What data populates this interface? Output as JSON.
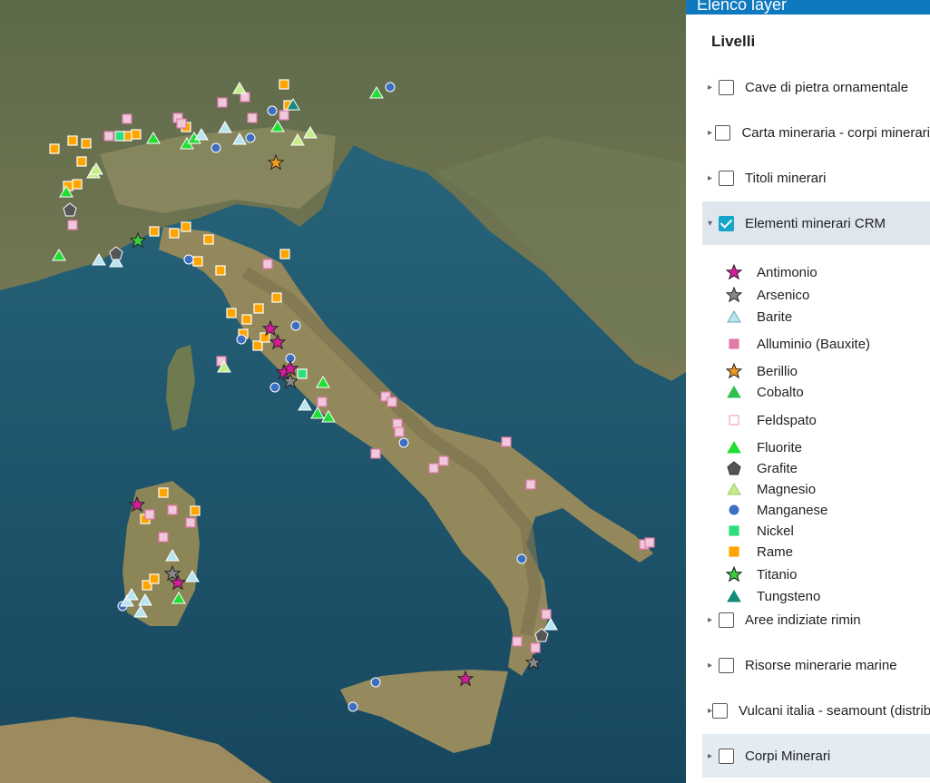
{
  "panel": {
    "header": "Elenco layer",
    "section_title": "Livelli",
    "layers": [
      {
        "label": "Cave di pietra ornamentale",
        "checked": false
      },
      {
        "label": "Carta mineraria - corpi minerari",
        "checked": false
      },
      {
        "label": "Titoli minerari",
        "checked": false
      },
      {
        "label": "Elementi minerari CRM",
        "checked": true,
        "expanded": true
      },
      {
        "label": "Aree indiziate rimin",
        "checked": false
      },
      {
        "label": "Risorse minerarie marine",
        "checked": false
      },
      {
        "label": "Vulcani italia - seamount (distribuzione)",
        "checked": false
      },
      {
        "label": "Corpi Minerari",
        "checked": false
      }
    ],
    "legend": [
      {
        "label": "Antimonio",
        "icon": "star-icon",
        "color": "#d81b9c",
        "stroke": "#222"
      },
      {
        "label": "Arsenico",
        "icon": "star-icon",
        "color": "#888888",
        "stroke": "#222"
      },
      {
        "label": "Barite",
        "icon": "triangle-icon",
        "color": "#b9e4f2",
        "stroke": "#6aa"
      },
      {
        "label": "Alluminio (Bauxite)",
        "icon": "square-icon",
        "color": "#e07aa9",
        "stroke": "#e07aa9"
      },
      {
        "label": "Berillio",
        "icon": "star-icon",
        "color": "#f29a1d",
        "stroke": "#222"
      },
      {
        "label": "Cobalto",
        "icon": "triangle-icon",
        "color": "#2fbf4f",
        "stroke": "#2fbf4f"
      },
      {
        "label": "Feldspato",
        "icon": "square-icon",
        "color": "#ffffff",
        "stroke": "#f0a4c8"
      },
      {
        "label": "Fluorite",
        "icon": "triangle-icon",
        "color": "#22dd33",
        "stroke": "#22dd33"
      },
      {
        "label": "Grafite",
        "icon": "pentagon-icon",
        "color": "#555555",
        "stroke": "#333"
      },
      {
        "label": "Magnesio",
        "icon": "triangle-icon",
        "color": "#c6ec8a",
        "stroke": "#9c6"
      },
      {
        "label": "Manganese",
        "icon": "circle-icon",
        "color": "#3c6fc2",
        "stroke": "#3c6fc2"
      },
      {
        "label": "Nickel",
        "icon": "square-icon",
        "color": "#2be07a",
        "stroke": "#2be07a"
      },
      {
        "label": "Rame",
        "icon": "square-icon",
        "color": "#ffa500",
        "stroke": "#ffa500"
      },
      {
        "label": "Titanio",
        "icon": "star-icon",
        "color": "#3ad13a",
        "stroke": "#111"
      },
      {
        "label": "Tungsteno",
        "icon": "triangle-icon",
        "color": "#138a7a",
        "stroke": "#138a7a"
      }
    ]
  },
  "map": {
    "sea_color": "#1f5a72",
    "land_color": "#8a8a5e"
  }
}
